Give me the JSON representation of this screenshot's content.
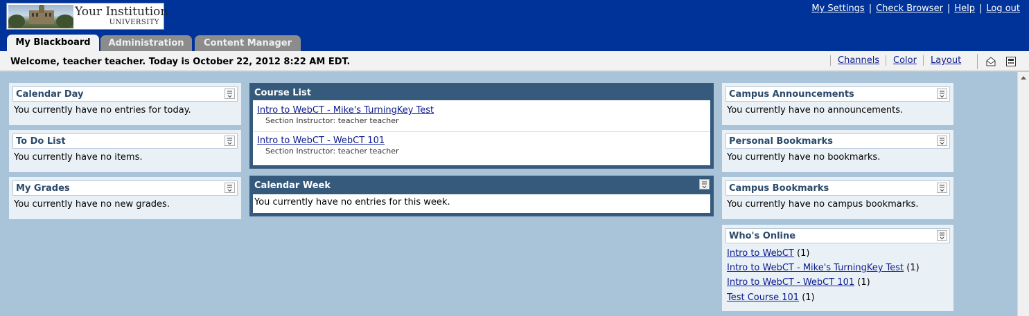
{
  "header": {
    "logo_name": "Your Institution",
    "logo_sub": "UNIVERSITY",
    "links": [
      "My Settings",
      "Check Browser",
      "Help",
      "Log out"
    ],
    "separator": "|"
  },
  "tabs": [
    {
      "label": "My Blackboard",
      "active": true
    },
    {
      "label": "Administration",
      "active": false
    },
    {
      "label": "Content Manager",
      "active": false
    }
  ],
  "welcome": {
    "message": "Welcome, teacher teacher. Today is October 22, 2012 8:22 AM EDT.",
    "links": [
      "Channels",
      "Color",
      "Layout"
    ],
    "icons": [
      "mail-icon",
      "calculator-icon"
    ]
  },
  "left": {
    "calendar_day": {
      "title": "Calendar Day",
      "text": "You currently have no entries for today."
    },
    "todo": {
      "title": "To Do List",
      "text": "You currently have no items."
    },
    "grades": {
      "title": "My Grades",
      "text": "You currently have no new grades."
    }
  },
  "center": {
    "course_list": {
      "title": "Course List",
      "courses": [
        {
          "name": "Intro to WebCT - Mike's TurningKey Test",
          "instructor": "Section Instructor: teacher teacher"
        },
        {
          "name": "Intro to WebCT - WebCT 101",
          "instructor": "Section Instructor: teacher teacher"
        }
      ]
    },
    "calendar_week": {
      "title": "Calendar Week",
      "text": "You currently have no entries for this week."
    }
  },
  "right": {
    "announcements": {
      "title": "Campus Announcements",
      "text": "You currently have no announcements."
    },
    "bookmarks": {
      "title": "Personal Bookmarks",
      "text": "You currently have no bookmarks."
    },
    "campus_bookmarks": {
      "title": "Campus Bookmarks",
      "text": "You currently have no campus bookmarks."
    },
    "whos_online": {
      "title": "Who's Online",
      "items": [
        {
          "course": "Intro to WebCT",
          "count": "(1)"
        },
        {
          "course": "Intro to WebCT - Mike's TurningKey Test",
          "count": "(1)"
        },
        {
          "course": "Intro to WebCT - WebCT 101",
          "count": "(1)"
        },
        {
          "course": "Test Course 101",
          "count": "(1)"
        }
      ]
    }
  },
  "colors": {
    "header_bg": "#00339a",
    "page_bg": "#a9c3d9",
    "module_bg": "#eaf1f6",
    "module_title": "#2b4a6b",
    "dark_module": "#355a7c",
    "link": "#0b1b8f"
  }
}
